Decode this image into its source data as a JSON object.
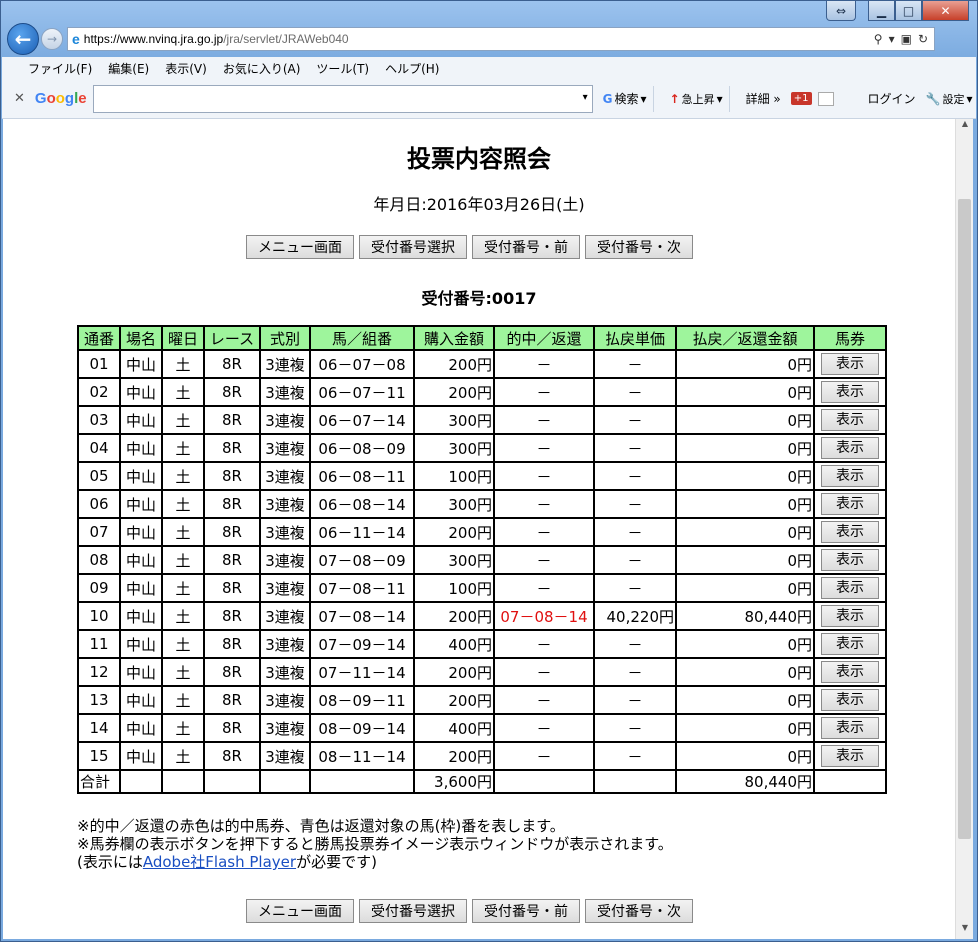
{
  "browser": {
    "url_domain": "https://www.nvinq.jra.go.jp",
    "url_path": "/jra/servlet/JRAWeb040",
    "menu": [
      "ファイル(F)",
      "編集(E)",
      "表示(V)",
      "お気に入り(A)",
      "ツール(T)",
      "ヘルプ(H)"
    ],
    "google": {
      "logo": "Google",
      "search_label": "検索",
      "rise_label": "急上昇",
      "detail_label": "詳細 »",
      "plus_label": "+1",
      "login_label": "ログイン",
      "settings_label": "設定"
    }
  },
  "page": {
    "title": "投票内容照会",
    "date_line": "年月日:2016年03月26日(土)",
    "receipt_line": "受付番号:0017",
    "buttons": [
      "メニュー画面",
      "受付番号選択",
      "受付番号・前",
      "受付番号・次"
    ],
    "table": {
      "headers": [
        "通番",
        "場名",
        "曜日",
        "レース",
        "式別",
        "馬／組番",
        "購入金額",
        "的中／返還",
        "払戻単価",
        "払戻／返還金額",
        "馬券"
      ],
      "show_label": "表示",
      "rows": [
        {
          "no": "01",
          "venue": "中山",
          "day": "土",
          "race": "8R",
          "type": "3連複",
          "combo": "06－07－08",
          "amount": "200円",
          "hit": "－",
          "unit": "－",
          "payout": "0円"
        },
        {
          "no": "02",
          "venue": "中山",
          "day": "土",
          "race": "8R",
          "type": "3連複",
          "combo": "06－07－11",
          "amount": "200円",
          "hit": "－",
          "unit": "－",
          "payout": "0円"
        },
        {
          "no": "03",
          "venue": "中山",
          "day": "土",
          "race": "8R",
          "type": "3連複",
          "combo": "06－07－14",
          "amount": "300円",
          "hit": "－",
          "unit": "－",
          "payout": "0円"
        },
        {
          "no": "04",
          "venue": "中山",
          "day": "土",
          "race": "8R",
          "type": "3連複",
          "combo": "06－08－09",
          "amount": "300円",
          "hit": "－",
          "unit": "－",
          "payout": "0円"
        },
        {
          "no": "05",
          "venue": "中山",
          "day": "土",
          "race": "8R",
          "type": "3連複",
          "combo": "06－08－11",
          "amount": "100円",
          "hit": "－",
          "unit": "－",
          "payout": "0円"
        },
        {
          "no": "06",
          "venue": "中山",
          "day": "土",
          "race": "8R",
          "type": "3連複",
          "combo": "06－08－14",
          "amount": "300円",
          "hit": "－",
          "unit": "－",
          "payout": "0円"
        },
        {
          "no": "07",
          "venue": "中山",
          "day": "土",
          "race": "8R",
          "type": "3連複",
          "combo": "06－11－14",
          "amount": "200円",
          "hit": "－",
          "unit": "－",
          "payout": "0円"
        },
        {
          "no": "08",
          "venue": "中山",
          "day": "土",
          "race": "8R",
          "type": "3連複",
          "combo": "07－08－09",
          "amount": "300円",
          "hit": "－",
          "unit": "－",
          "payout": "0円"
        },
        {
          "no": "09",
          "venue": "中山",
          "day": "土",
          "race": "8R",
          "type": "3連複",
          "combo": "07－08－11",
          "amount": "100円",
          "hit": "－",
          "unit": "－",
          "payout": "0円"
        },
        {
          "no": "10",
          "venue": "中山",
          "day": "土",
          "race": "8R",
          "type": "3連複",
          "combo": "07－08－14",
          "amount": "200円",
          "hit": "07－08－14",
          "unit": "40,220円",
          "payout": "80,440円",
          "is_hit": true
        },
        {
          "no": "11",
          "venue": "中山",
          "day": "土",
          "race": "8R",
          "type": "3連複",
          "combo": "07－09－14",
          "amount": "400円",
          "hit": "－",
          "unit": "－",
          "payout": "0円"
        },
        {
          "no": "12",
          "venue": "中山",
          "day": "土",
          "race": "8R",
          "type": "3連複",
          "combo": "07－11－14",
          "amount": "200円",
          "hit": "－",
          "unit": "－",
          "payout": "0円"
        },
        {
          "no": "13",
          "venue": "中山",
          "day": "土",
          "race": "8R",
          "type": "3連複",
          "combo": "08－09－11",
          "amount": "200円",
          "hit": "－",
          "unit": "－",
          "payout": "0円"
        },
        {
          "no": "14",
          "venue": "中山",
          "day": "土",
          "race": "8R",
          "type": "3連複",
          "combo": "08－09－14",
          "amount": "400円",
          "hit": "－",
          "unit": "－",
          "payout": "0円"
        },
        {
          "no": "15",
          "venue": "中山",
          "day": "土",
          "race": "8R",
          "type": "3連複",
          "combo": "08－11－14",
          "amount": "200円",
          "hit": "－",
          "unit": "－",
          "payout": "0円"
        }
      ],
      "total_label": "合計",
      "total_amount": "3,600円",
      "total_payout": "80,440円"
    },
    "notes": {
      "line1": "※的中／返還の赤色は的中馬券、青色は返還対象の馬(枠)番を表します。",
      "line2": "※馬券欄の表示ボタンを押下すると勝馬投票券イメージ表示ウィンドウが表示されます。",
      "line3_prefix": "(表示には",
      "line3_link": "Adobe社Flash Player",
      "line3_suffix": "が必要です)"
    }
  }
}
